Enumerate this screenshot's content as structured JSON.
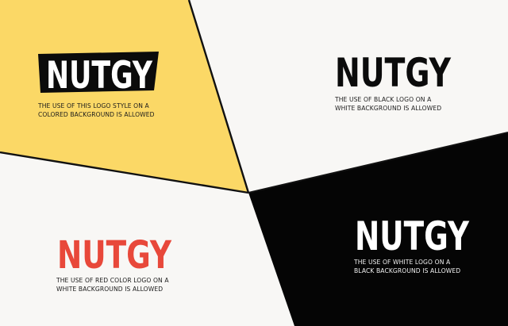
{
  "brand": {
    "wordmark": "NUTGY"
  },
  "colors": {
    "yellow_panel": "#fbd866",
    "white_panel": "#f8f7f5",
    "black_panel": "#050505",
    "divider": "#111111",
    "logo_red": "#e8483a",
    "logo_black": "#0b0b0b",
    "logo_white": "#ffffff"
  },
  "panels": {
    "yellow": {
      "caption_line1": "THE USE OF THIS LOGO STYLE ON A",
      "caption_line2": "COLORED BACKGROUND IS ALLOWED"
    },
    "black_logo": {
      "caption_line1": "THE USE OF BLACK LOGO ON A",
      "caption_line2": "WHITE BACKGROUND IS ALLOWED"
    },
    "red_logo": {
      "caption_line1": "THE USE OF RED COLOR LOGO ON A",
      "caption_line2": "WHITE BACKGROUND IS ALLOWED"
    },
    "white_logo": {
      "caption_line1": "THE USE OF WHITE LOGO ON A",
      "caption_line2": "BLACK BACKGROUND IS ALLOWED"
    }
  }
}
